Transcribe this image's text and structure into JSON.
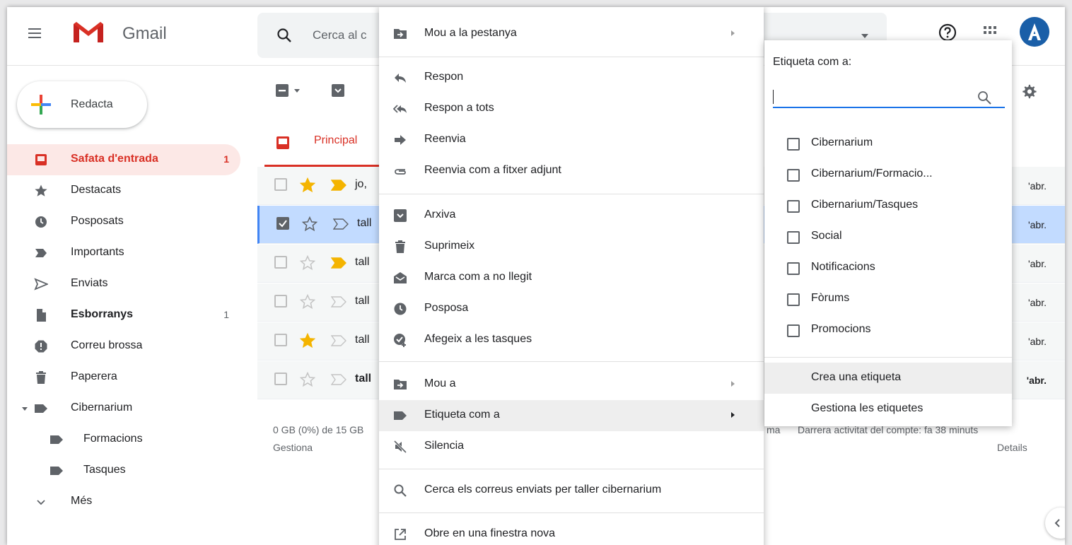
{
  "app": {
    "name": "Gmail"
  },
  "search": {
    "placeholder_visible": "Cerca al c"
  },
  "compose": {
    "label": "Redacta"
  },
  "sidebar": {
    "items": [
      {
        "label": "Safata d'entrada",
        "count": "1",
        "icon": "inbox-icon"
      },
      {
        "label": "Destacats",
        "count": "",
        "icon": "star-icon"
      },
      {
        "label": "Posposats",
        "count": "",
        "icon": "clock-icon"
      },
      {
        "label": "Importants",
        "count": "",
        "icon": "important-icon"
      },
      {
        "label": "Enviats",
        "count": "",
        "icon": "send-icon"
      },
      {
        "label": "Esborranys",
        "count": "1",
        "icon": "draft-icon"
      },
      {
        "label": "Correu brossa",
        "count": "",
        "icon": "spam-icon"
      },
      {
        "label": "Paperera",
        "count": "",
        "icon": "trash-icon"
      },
      {
        "label": "Cibernarium",
        "count": "",
        "icon": "label-icon"
      },
      {
        "label": "Formacions",
        "count": "",
        "icon": "label-icon"
      },
      {
        "label": "Tasques",
        "count": "",
        "icon": "label-icon"
      },
      {
        "label": "Més",
        "count": "",
        "icon": "chevron-down-icon"
      }
    ]
  },
  "tabs": {
    "primary": "Principal"
  },
  "rows": [
    {
      "sender": "jo,",
      "date": "'abr.",
      "selected": false,
      "starred": true,
      "important": true,
      "bold": false
    },
    {
      "sender": "tall",
      "date": "'abr.",
      "selected": true,
      "starred": false,
      "important": false,
      "bold": false
    },
    {
      "sender": "tall",
      "date": "'abr.",
      "selected": false,
      "starred": false,
      "important": true,
      "bold": false
    },
    {
      "sender": "tall",
      "date": "'abr.",
      "selected": false,
      "starred": false,
      "important": false,
      "bold": false
    },
    {
      "sender": "tall",
      "date": "'abr.",
      "selected": false,
      "starred": true,
      "important": false,
      "bold": false
    },
    {
      "sender": "tall",
      "date": "'abr.",
      "selected": false,
      "starred": false,
      "important": false,
      "bold": true
    }
  ],
  "footer": {
    "storage": "0 GB (0%) de 15 GB",
    "manage": "Gestiona",
    "program_fragment": "ma",
    "activity": "Darrera activitat del compte: fa 38 minuts",
    "details": "Details"
  },
  "context_menu": {
    "move_to_tab": "Mou a la pestanya",
    "reply": "Respon",
    "reply_all": "Respon a tots",
    "forward": "Reenvia",
    "forward_attachment": "Reenvia com a fitxer adjunt",
    "archive": "Arxiva",
    "delete": "Suprimeix",
    "mark_unread": "Marca com a no llegit",
    "snooze": "Posposa",
    "add_tasks": "Afegeix a les tasques",
    "move_to": "Mou a",
    "label_as": "Etiqueta com a",
    "mute": "Silencia",
    "search_sent": "Cerca els correus enviats per taller cibernarium",
    "open_new_window": "Obre en una finestra nova"
  },
  "label_menu": {
    "title": "Etiqueta com a:",
    "labels": [
      "Cibernarium",
      "Cibernarium/Formacio...",
      "Cibernarium/Tasques",
      "Social",
      "Notificacions",
      "Fòrums",
      "Promocions"
    ],
    "create": "Crea una etiqueta",
    "manage": "Gestiona les etiquetes"
  },
  "colors": {
    "accent_red": "#d93025",
    "selected_row": "#c2dbff",
    "focus_blue": "#1a73e8",
    "star_yellow": "#f4b400"
  }
}
